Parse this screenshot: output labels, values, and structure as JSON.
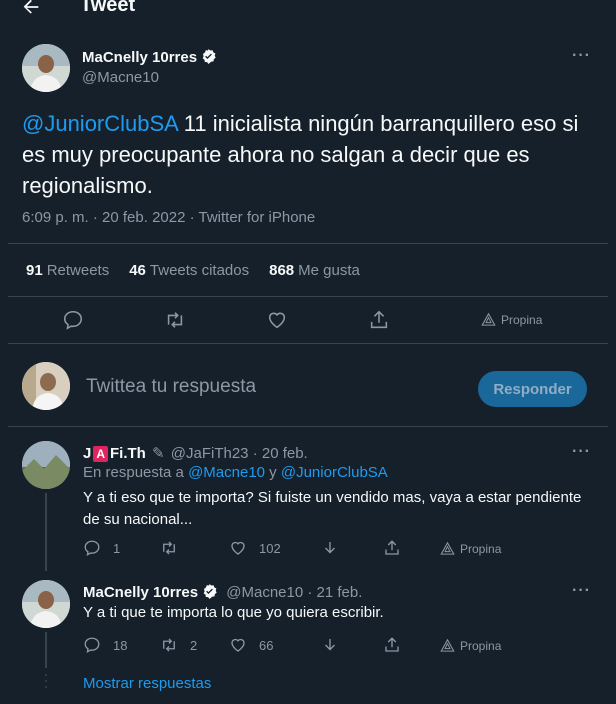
{
  "header": {
    "title": "Tweet",
    "back_icon": "arrow-left-icon"
  },
  "tweet": {
    "author_name": "MaCnelly 10rres",
    "author_handle": "@Macne10",
    "mention": "@JuniorClubSA",
    "text": " 11 inicialista ningún barranquillero eso si es muy preocupante ahora no salgan a decir que es regionalismo.",
    "time": "6:09 p. m. · 20 feb. 2022 · Twitter for iPhone",
    "stats": {
      "retweets_count": "91",
      "retweets_label": "Retweets",
      "quotes_count": "46",
      "quotes_label": "Tweets citados",
      "likes_count": "868",
      "likes_label": "Me gusta"
    },
    "promote_label": "Propina"
  },
  "compose": {
    "placeholder": "Twittea tu respuesta",
    "button_label": "Responder"
  },
  "replies": [
    {
      "name_prefix": "J",
      "name_badge": "A",
      "name_suffix": "Fi.Th",
      "handle_date": "@JaFiTh23 · 20 feb.",
      "reply_to_prefix": "En respuesta a ",
      "reply_to_user1": "@Macne10",
      "reply_to_join": " y ",
      "reply_to_user2": "@JuniorClubSA",
      "text": "Y a ti eso que te importa? Si fuiste un vendido mas, vaya a estar pendiente de su nacional...",
      "reply_count": "1",
      "retweet_count": "",
      "like_count": "102",
      "promote_label": "Propina"
    },
    {
      "name": "MaCnelly 10rres",
      "handle_date": "@Macne10 · 21 feb.",
      "text": "Y a ti que te importa lo que yo quiera escribir.",
      "reply_count": "18",
      "retweet_count": "2",
      "like_count": "66",
      "promote_label": "Propina"
    }
  ],
  "show_replies": "Mostrar respuestas",
  "colors": {
    "background": "#15202b",
    "accent": "#1d9bf0",
    "muted": "#8b98a5",
    "divider": "#38444d"
  }
}
